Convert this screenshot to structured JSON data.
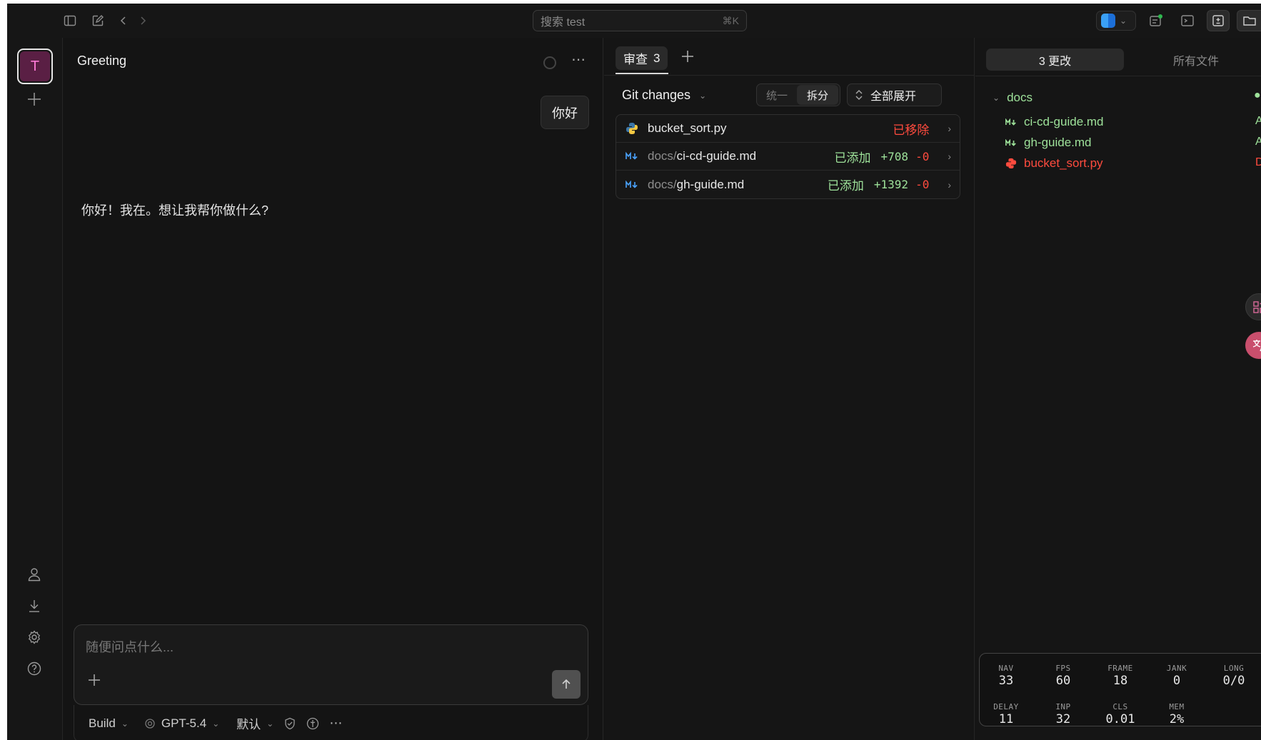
{
  "topbar": {
    "search_placeholder": "搜索 test",
    "search_shortcut": "⌘K"
  },
  "rail": {
    "workspace_initial": "T"
  },
  "chat": {
    "title": "Greeting",
    "user_message": "你好",
    "assistant_message": "你好！我在。想让我帮你做什么?",
    "composer_placeholder": "随便问点什么...",
    "toolbar": {
      "mode": "Build",
      "model": "GPT-5.4",
      "permission": "默认"
    }
  },
  "review": {
    "tab_label": "审查",
    "tab_count": "3",
    "git_title": "Git changes",
    "view_unified": "统一",
    "view_split": "拆分",
    "expand_all": "全部展开",
    "files": [
      {
        "dir": "",
        "name": "bucket_sort.py",
        "status": "已移除",
        "added": "",
        "removed": "",
        "type": "python"
      },
      {
        "dir": "docs/",
        "name": "ci-cd-guide.md",
        "status": "已添加",
        "added": "+708",
        "removed": "-0",
        "type": "markdown"
      },
      {
        "dir": "docs/",
        "name": "gh-guide.md",
        "status": "已添加",
        "added": "+1392",
        "removed": "-0",
        "type": "markdown"
      }
    ]
  },
  "tree": {
    "tab_changes": "3 更改",
    "tab_all": "所有文件",
    "folder": "docs",
    "items": [
      {
        "name": "ci-cd-guide.md",
        "badge": "A"
      },
      {
        "name": "gh-guide.md",
        "badge": "A"
      },
      {
        "name": "bucket_sort.py",
        "badge": "D"
      }
    ]
  },
  "perf": {
    "nav_label": "NAV",
    "nav": "33",
    "fps_label": "FPS",
    "fps": "60",
    "frame_label": "FRAME",
    "frame": "18",
    "jank_label": "JANK",
    "jank": "0",
    "long_label": "LONG",
    "long": "0/0",
    "delay_label": "DELAY",
    "delay": "11",
    "inp_label": "INP",
    "inp": "32",
    "cls_label": "CLS",
    "cls": "0.01",
    "mem_label": "MEM",
    "mem": "2%"
  },
  "colors": {
    "added": "#9ee29a",
    "removed": "#ff4b3e",
    "workspace_bg": "#5a1f44"
  }
}
